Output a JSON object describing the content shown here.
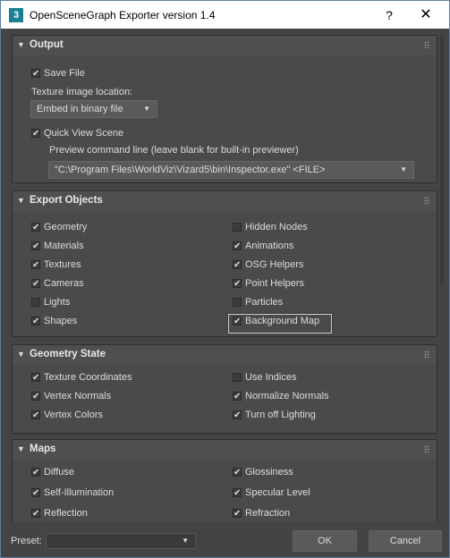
{
  "window": {
    "app_icon": "3",
    "title": "OpenSceneGraph Exporter version 1.4",
    "help": "?",
    "close": "✕"
  },
  "output": {
    "title": "Output",
    "save_file": "Save File",
    "texture_location_label": "Texture image location:",
    "texture_location_value": "Embed in binary file",
    "quick_view": "Quick View Scene",
    "preview_label": "Preview command line (leave blank for built-in previewer)",
    "preview_value": "\"C:\\Program Files\\WorldViz\\Vizard5\\bin\\Inspector.exe\" <FILE>"
  },
  "export_objects": {
    "title": "Export Objects",
    "left": [
      {
        "label": "Geometry",
        "checked": true
      },
      {
        "label": "Materials",
        "checked": true
      },
      {
        "label": "Textures",
        "checked": true
      },
      {
        "label": "Cameras",
        "checked": true
      },
      {
        "label": "Lights",
        "checked": false
      },
      {
        "label": "Shapes",
        "checked": true
      }
    ],
    "right": [
      {
        "label": "Hidden Nodes",
        "checked": false
      },
      {
        "label": "Animations",
        "checked": true
      },
      {
        "label": "OSG Helpers",
        "checked": true
      },
      {
        "label": "Point Helpers",
        "checked": true
      },
      {
        "label": "Particles",
        "checked": false
      },
      {
        "label": "Background Map",
        "checked": true
      }
    ]
  },
  "geometry_state": {
    "title": "Geometry State",
    "left": [
      {
        "label": "Texture Coordinates",
        "checked": true
      },
      {
        "label": "Vertex Normals",
        "checked": true
      },
      {
        "label": "Vertex Colors",
        "checked": true
      }
    ],
    "right": [
      {
        "label": "Use Indices",
        "checked": false
      },
      {
        "label": "Normalize Normals",
        "checked": true
      },
      {
        "label": "Turn off Lighting",
        "checked": true
      }
    ]
  },
  "maps": {
    "title": "Maps",
    "left": [
      {
        "label": "Diffuse",
        "checked": true
      },
      {
        "label": "Self-Illumination",
        "checked": true
      },
      {
        "label": "Reflection",
        "checked": true
      }
    ],
    "right": [
      {
        "label": "Glossiness",
        "checked": true
      },
      {
        "label": "Specular Level",
        "checked": true
      },
      {
        "label": "Refraction",
        "checked": true
      }
    ]
  },
  "footer": {
    "preset_label": "Preset:",
    "preset_value": "",
    "ok": "OK",
    "cancel": "Cancel"
  },
  "icons": {
    "collapse": "▼",
    "dropdown": "▼",
    "check": "✔"
  },
  "colors": {
    "panel_bg": "#444444",
    "rollout_bg": "#4a4a4a",
    "text": "#dcdcdc",
    "app_icon_bg": "#1a7f8f"
  }
}
